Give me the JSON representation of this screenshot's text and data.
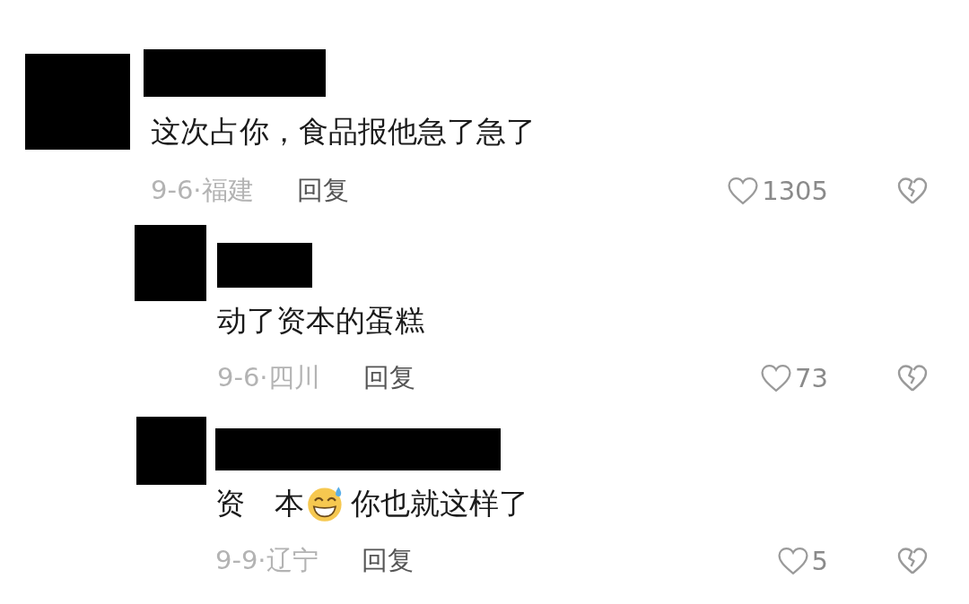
{
  "comments": [
    {
      "kind": "top",
      "segments": [
        {
          "kind": "text",
          "text": "这次占你，食品报他急了急了"
        }
      ],
      "date_location": "9-6·福建",
      "reply": "回复",
      "likes": "1305"
    },
    {
      "kind": "reply",
      "segments": [
        {
          "kind": "text",
          "text": "动了资本的蛋糕"
        }
      ],
      "date_location": "9-6·四川",
      "reply": "回复",
      "likes": "73"
    },
    {
      "kind": "reply",
      "segments": [
        {
          "kind": "text",
          "text": "资　本"
        },
        {
          "kind": "emoji"
        },
        {
          "kind": "text",
          "text": "你也就这样了"
        }
      ],
      "date_location": "9-9·辽宁",
      "reply": "回复",
      "likes": "5"
    }
  ]
}
